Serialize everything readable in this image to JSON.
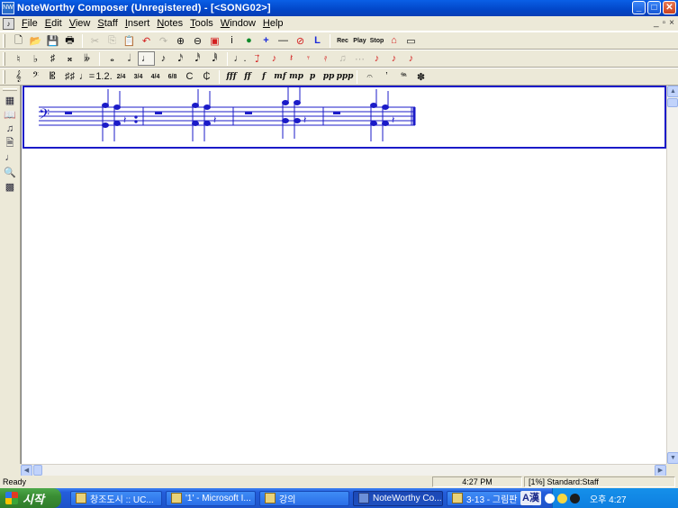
{
  "window": {
    "title": "NoteWorthy Composer (Unregistered) - [<SONG02>]",
    "app_icon_text": "NW",
    "minimize": "_",
    "maximize": "□",
    "close": "✕"
  },
  "menu": {
    "items": [
      "File",
      "Edit",
      "View",
      "Staff",
      "Insert",
      "Notes",
      "Tools",
      "Window",
      "Help"
    ],
    "mdi_minimize": "_",
    "mdi_restore": "▫",
    "mdi_close": "×"
  },
  "toolbar1": {
    "buttons": [
      {
        "name": "new-icon",
        "glyph": "🗋"
      },
      {
        "name": "open-icon",
        "glyph": "📂"
      },
      {
        "name": "save-icon",
        "glyph": "💾"
      },
      {
        "name": "print-icon",
        "glyph": "🖶"
      },
      {
        "name": "cut-icon",
        "glyph": "✂"
      },
      {
        "name": "copy-icon",
        "glyph": "⎘"
      },
      {
        "name": "paste-icon",
        "glyph": "📋"
      },
      {
        "name": "undo-icon",
        "glyph": "↶"
      },
      {
        "name": "redo-icon",
        "glyph": "↷"
      },
      {
        "name": "zoom-in-icon",
        "glyph": "⊕"
      },
      {
        "name": "zoom-out-icon",
        "glyph": "⊖"
      },
      {
        "name": "staff-props-icon",
        "glyph": "▣"
      },
      {
        "name": "info-icon",
        "glyph": "i"
      },
      {
        "name": "globe-icon",
        "glyph": "●"
      },
      {
        "name": "add-staff-icon",
        "glyph": "+"
      },
      {
        "name": "remove-staff-icon",
        "glyph": "—"
      },
      {
        "name": "no-icon",
        "glyph": "⊘"
      },
      {
        "name": "lyrics-icon",
        "glyph": "L"
      }
    ],
    "transport": {
      "rec": "Rec",
      "play": "Play",
      "stop": "Stop"
    },
    "keyboard_icon": "▭"
  },
  "toolbar2": {
    "accidentals": [
      "♮",
      "♭",
      "♯",
      "𝄪",
      "𝄫"
    ],
    "durations": [
      "𝅝",
      "𝅗𝅥",
      "♩",
      "♪",
      "𝅘𝅥𝅯",
      "𝅘𝅥𝅰",
      "𝅘𝅥𝅱"
    ],
    "rests": [
      "♩.",
      "♩⃗",
      "♪",
      "𝄽",
      "𝄾",
      "𝄿",
      "♫",
      "⋯",
      "♪",
      "♪",
      "♪"
    ]
  },
  "toolbar3": {
    "clefs": [
      "𝄞",
      "𝄢",
      "𝄡"
    ],
    "meters": [
      "2/4",
      "3/4",
      "4/4",
      "6/8",
      "C",
      "₵"
    ],
    "dynamics": [
      "fff",
      "ff",
      "f",
      "mf",
      "mp",
      "p",
      "pp",
      "ppp"
    ],
    "misc": [
      "𝄐",
      "ʼ",
      "𝆮",
      "✽"
    ]
  },
  "left_toolbar": {
    "buttons": [
      {
        "name": "staff-icon",
        "glyph": "▦"
      },
      {
        "name": "book-icon",
        "glyph": "📖"
      },
      {
        "name": "instrument-icon",
        "glyph": "♫"
      },
      {
        "name": "page-icon",
        "glyph": "🗎"
      },
      {
        "name": "note-entry-icon",
        "glyph": "♩"
      },
      {
        "name": "magnify-icon",
        "glyph": "🔍"
      },
      {
        "name": "grid-icon",
        "glyph": "▩"
      }
    ]
  },
  "score": {
    "clef": "𝄢"
  },
  "status": {
    "ready": "Ready",
    "time": "4:27 PM",
    "staff_info": "[1%] Standard:Staff"
  },
  "taskbar": {
    "start": "시작",
    "tasks": [
      {
        "label": "창조도시 :: UC...",
        "active": false
      },
      {
        "label": "'1' - Microsoft I...",
        "active": false
      },
      {
        "label": "강의",
        "active": false
      },
      {
        "label": "NoteWorthy Co...",
        "active": true
      },
      {
        "label": "3-13 - 그림판",
        "active": false
      }
    ],
    "ime": "A漢",
    "clock": "오후 4:27"
  }
}
